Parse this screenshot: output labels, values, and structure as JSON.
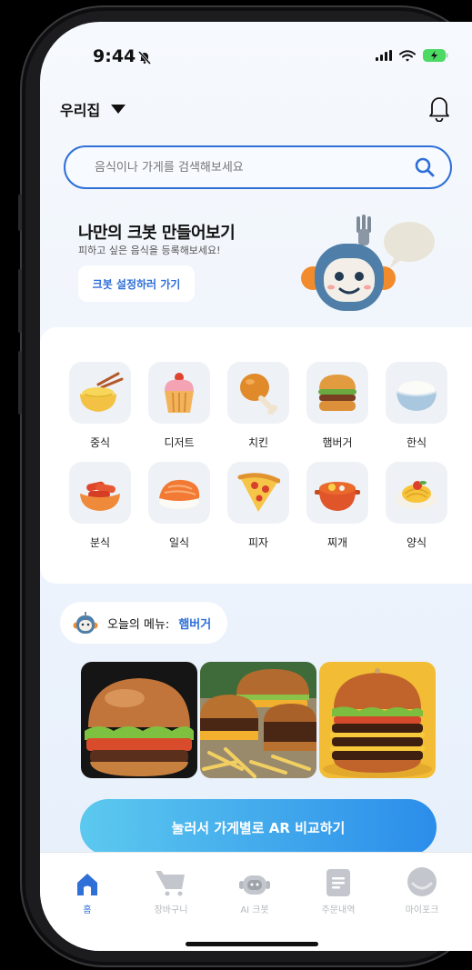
{
  "status_bar": {
    "time": "9:44"
  },
  "header": {
    "location": "우리집"
  },
  "search": {
    "placeholder": "음식이나 가게를 검색해보세요"
  },
  "banner": {
    "title": "나만의 크봇 만들어보기",
    "subtitle": "피하고 싶은 음식을 등록해보세요!",
    "button_label": "크봇 설정하러 가기"
  },
  "categories": [
    {
      "label": "중식",
      "icon": "noodles-icon"
    },
    {
      "label": "디저트",
      "icon": "cupcake-icon"
    },
    {
      "label": "치킨",
      "icon": "chicken-leg-icon"
    },
    {
      "label": "햄버거",
      "icon": "hamburger-icon"
    },
    {
      "label": "한식",
      "icon": "rice-bowl-icon"
    },
    {
      "label": "분식",
      "icon": "tteokbokki-icon"
    },
    {
      "label": "일식",
      "icon": "sushi-icon"
    },
    {
      "label": "피자",
      "icon": "pizza-icon"
    },
    {
      "label": "찌개",
      "icon": "stew-pot-icon"
    },
    {
      "label": "양식",
      "icon": "pasta-icon"
    }
  ],
  "today_menu": {
    "label": "오늘의 메뉴:",
    "value": "햄버거"
  },
  "ar_button": {
    "label": "눌러서 가게별로 AR 비교하기"
  },
  "tabs": [
    {
      "label": "홈",
      "active": true
    },
    {
      "label": "장바구니",
      "active": false
    },
    {
      "label": "AI 크봇",
      "active": false
    },
    {
      "label": "주문내역",
      "active": false
    },
    {
      "label": "마이포크",
      "active": false
    }
  ],
  "colors": {
    "accent": "#2f6fd8",
    "ar_gradient_start": "#5cc9ef",
    "ar_gradient_end": "#2b8dea"
  }
}
